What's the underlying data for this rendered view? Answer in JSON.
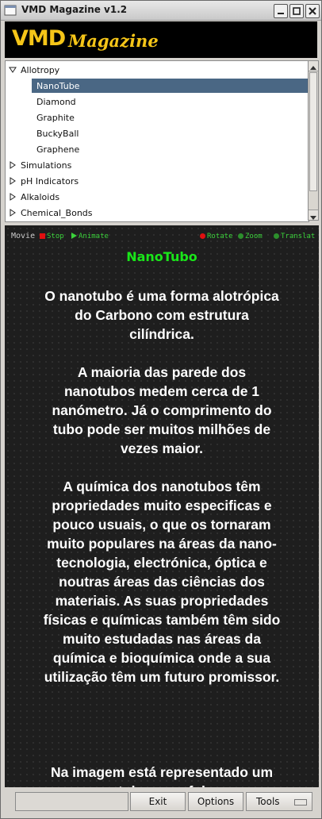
{
  "window": {
    "title": "VMD Magazine v1.2"
  },
  "banner": {
    "brand": "VMD",
    "subtitle": "Magazine",
    "colors": {
      "background": "#000000",
      "text": "#f5c518"
    }
  },
  "tree": {
    "items": [
      {
        "label": "Allotropy",
        "level": 0,
        "expanded": true
      },
      {
        "label": "NanoTube",
        "level": 1,
        "selected": true
      },
      {
        "label": "Diamond",
        "level": 1
      },
      {
        "label": "Graphite",
        "level": 1
      },
      {
        "label": "BuckyBall",
        "level": 1
      },
      {
        "label": "Graphene",
        "level": 1
      },
      {
        "label": "Simulations",
        "level": 0,
        "expanded": false
      },
      {
        "label": "pH Indicators",
        "level": 0,
        "expanded": false
      },
      {
        "label": "Alkaloids",
        "level": 0,
        "expanded": false
      },
      {
        "label": "Chemical_Bonds",
        "level": 0,
        "expanded": false
      }
    ],
    "selection_color": "#4a6784"
  },
  "controls": {
    "movie": "Movie",
    "stop": "Stop",
    "animate": "Animate",
    "rotate": "Rotate",
    "zoom": "Zoom",
    "translate": "Translat",
    "colors": {
      "stop": "#e01010",
      "rotate": "#e01010",
      "label": "#3bd13b"
    }
  },
  "article": {
    "title": "NanoTubo",
    "title_color": "#19e619",
    "paragraphs": [
      "O nanotubo é uma forma alotrópica do Carbono com estrutura cilíndrica.",
      "A maioria das parede dos nanotubos medem cerca de 1 nanómetro. Já o comprimento do tubo pode ser muitos milhões de vezes maior.",
      "A química dos nanotubos têm propriedades muito especificas e pouco usuais, o que os tornaram muito populares na áreas da nano-tecnologia, electrónica, óptica e noutras áreas das ciências dos materiais. As suas propriedades físicas e químicas também têm sido muito estudadas nas áreas da química e bioquímica onde a sua utilização têm um futuro promissor.",
      "Na imagem está representado um nano-tubo e um fulereno"
    ]
  },
  "bottombar": {
    "exit": "Exit",
    "options": "Options",
    "tools": "Tools"
  }
}
